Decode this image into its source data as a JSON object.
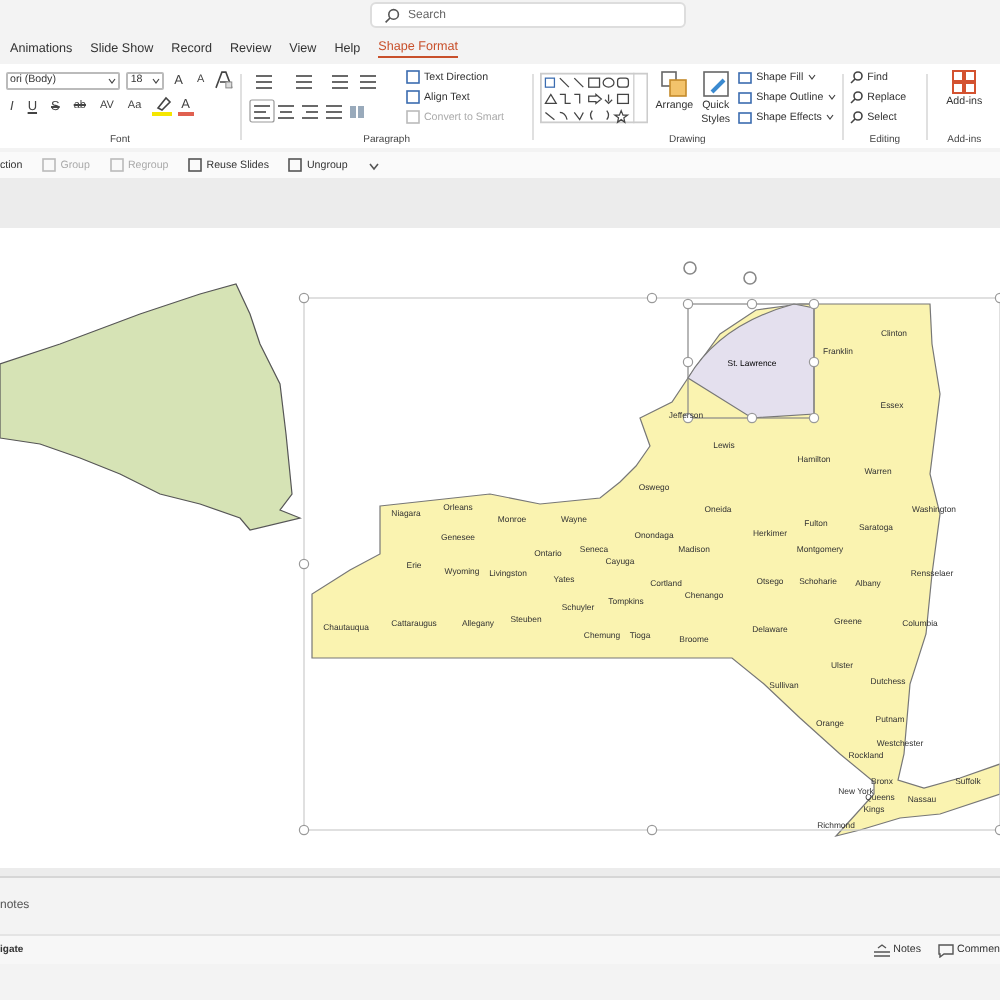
{
  "search": {
    "placeholder": "Search"
  },
  "tabs": [
    {
      "label": "Animations",
      "selected": false
    },
    {
      "label": "Slide Show",
      "selected": false
    },
    {
      "label": "Record",
      "selected": false
    },
    {
      "label": "Review",
      "selected": false
    },
    {
      "label": "View",
      "selected": false
    },
    {
      "label": "Help",
      "selected": false
    },
    {
      "label": "Shape Format",
      "selected": true
    }
  ],
  "ribbon": {
    "font": {
      "name": "ori (Body)",
      "size": "18",
      "grow": "A",
      "shrink": "A",
      "styles": [
        "I",
        "U",
        "S",
        "ab",
        "AV",
        "Aa"
      ],
      "color_letter": "A",
      "label": "Font"
    },
    "paragraph": {
      "commands": [
        {
          "label": "Text Direction",
          "disabled": false
        },
        {
          "label": "Align Text",
          "disabled": false
        },
        {
          "label": "Convert to Smart",
          "disabled": true
        }
      ],
      "label": "Paragraph"
    },
    "drawing": {
      "arrange": "Arrange",
      "quick_styles": [
        "Quick",
        "Styles"
      ],
      "commands": [
        "Shape Fill",
        "Shape Outline",
        "Shape Effects"
      ],
      "label": "Drawing"
    },
    "editing": {
      "commands": [
        "Find",
        "Replace",
        "Select"
      ],
      "label": "Editing"
    },
    "addins": {
      "button": "Add-ins",
      "label": "Add-ins"
    }
  },
  "quick_bar": [
    {
      "label": "ction",
      "disabled": false
    },
    {
      "label": "Group",
      "disabled": true
    },
    {
      "label": "Regroup",
      "disabled": true
    },
    {
      "label": "Reuse Slides",
      "disabled": false
    },
    {
      "label": "Ungroup",
      "disabled": false
    }
  ],
  "slide": {
    "counties": [
      {
        "name": "St. Lawrence",
        "selected": true
      },
      {
        "name": "Franklin",
        "selected": false
      },
      {
        "name": "Clinton",
        "selected": false
      },
      {
        "name": "Essex",
        "selected": false
      },
      {
        "name": "Jefferson",
        "selected": false
      },
      {
        "name": "Lewis",
        "selected": false
      },
      {
        "name": "Hamilton",
        "selected": false
      },
      {
        "name": "Warren",
        "selected": false
      },
      {
        "name": "Washington",
        "selected": false
      },
      {
        "name": "Oswego",
        "selected": false
      },
      {
        "name": "Oneida",
        "selected": false
      },
      {
        "name": "Herkimer",
        "selected": false
      },
      {
        "name": "Fulton",
        "selected": false
      },
      {
        "name": "Saratoga",
        "selected": false
      },
      {
        "name": "Montgomery",
        "selected": false
      },
      {
        "name": "Niagara",
        "selected": false
      },
      {
        "name": "Orleans",
        "selected": false
      },
      {
        "name": "Monroe",
        "selected": false
      },
      {
        "name": "Wayne",
        "selected": false
      },
      {
        "name": "Onondaga",
        "selected": false
      },
      {
        "name": "Madison",
        "selected": false
      },
      {
        "name": "Genesee",
        "selected": false
      },
      {
        "name": "Erie",
        "selected": false
      },
      {
        "name": "Wyoming",
        "selected": false
      },
      {
        "name": "Livingston",
        "selected": false
      },
      {
        "name": "Ontario",
        "selected": false
      },
      {
        "name": "Seneca",
        "selected": false
      },
      {
        "name": "Cayuga",
        "selected": false
      },
      {
        "name": "Yates",
        "selected": false
      },
      {
        "name": "Cortland",
        "selected": false
      },
      {
        "name": "Otsego",
        "selected": false
      },
      {
        "name": "Schoharie",
        "selected": false
      },
      {
        "name": "Albany",
        "selected": false
      },
      {
        "name": "Rensselaer",
        "selected": false
      },
      {
        "name": "Chautauqua",
        "selected": false
      },
      {
        "name": "Cattaraugus",
        "selected": false
      },
      {
        "name": "Allegany",
        "selected": false
      },
      {
        "name": "Steuben",
        "selected": false
      },
      {
        "name": "Schuyler",
        "selected": false
      },
      {
        "name": "Tompkins",
        "selected": false
      },
      {
        "name": "Chemung",
        "selected": false
      },
      {
        "name": "Tioga",
        "selected": false
      },
      {
        "name": "Chenango",
        "selected": false
      },
      {
        "name": "Broome",
        "selected": false
      },
      {
        "name": "Delaware",
        "selected": false
      },
      {
        "name": "Greene",
        "selected": false
      },
      {
        "name": "Columbia",
        "selected": false
      },
      {
        "name": "Ulster",
        "selected": false
      },
      {
        "name": "Dutchess",
        "selected": false
      },
      {
        "name": "Sullivan",
        "selected": false
      },
      {
        "name": "Orange",
        "selected": false
      },
      {
        "name": "Putnam",
        "selected": false
      },
      {
        "name": "Westchester",
        "selected": false
      },
      {
        "name": "Rockland",
        "selected": false
      },
      {
        "name": "Bronx",
        "selected": false
      },
      {
        "name": "New York",
        "selected": false
      },
      {
        "name": "Queens",
        "selected": false
      },
      {
        "name": "Nassau",
        "selected": false
      },
      {
        "name": "Suffolk",
        "selected": false
      },
      {
        "name": "Kings",
        "selected": false
      },
      {
        "name": "Richmond",
        "selected": false
      }
    ]
  },
  "notes": {
    "hint": "notes"
  },
  "status_bar": {
    "left": "igate",
    "notes": "Notes",
    "comments": "Commen"
  }
}
